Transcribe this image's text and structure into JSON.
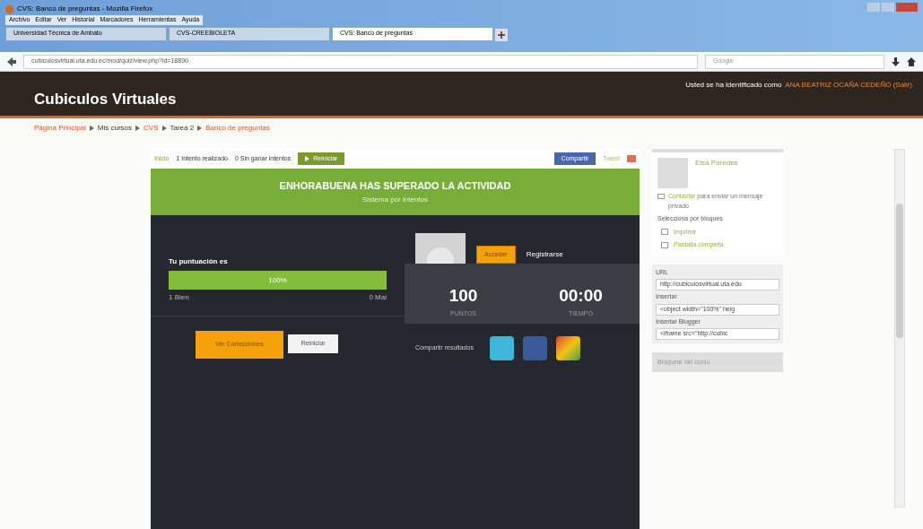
{
  "window": {
    "title": "CVS: Banco de preguntas - Mozilla Firefox"
  },
  "menu": [
    "Archivo",
    "Editar",
    "Ver",
    "Historial",
    "Marcadores",
    "Herramientas",
    "Ayuda"
  ],
  "tabs": [
    {
      "label": "Universidad Técnica de Ambato",
      "selected": false
    },
    {
      "label": "CVS-CREEBIOLETA",
      "selected": false
    },
    {
      "label": "CVS: Banco de preguntas",
      "selected": true
    }
  ],
  "address": {
    "value": "cubiculosvirtual.uta.edu.ec/mod/quiz/view.php?id=18890"
  },
  "search": {
    "placeholder": "Google"
  },
  "header": {
    "site_name": "Cubiculos Virtuales",
    "login_text": "Usted se ha identificado como",
    "user": "ANA BEATRIZ OCAÑA CEDEÑO (Salir)"
  },
  "breadcrumb": [
    {
      "label": "Página Principal",
      "link": true
    },
    {
      "label": "Mis cursos",
      "link": false
    },
    {
      "label": "CVS",
      "link": true
    },
    {
      "label": "Tarea 2",
      "link": false
    },
    {
      "label": "Banco de preguntas",
      "link": true
    }
  ],
  "quiz": {
    "toolbar": {
      "home": "Inicio",
      "attempts": "1 Intento realizado",
      "remaining": "0 Sin ganar intentos",
      "restart": "Reiniciar",
      "share": "Compartir",
      "tweet": "Tweet"
    },
    "banner": {
      "title": "ENHORABUENA HAS SUPERADO LA ACTIVIDAD",
      "subtitle": "Sistema por intentos"
    },
    "score": {
      "label": "Tu puntuación es",
      "level": 1,
      "reading": "100%",
      "correct": "1 Bien",
      "wrong": "0 Mal"
    },
    "account": {
      "login": "Acceder",
      "register": "Registrarse"
    },
    "stats": [
      {
        "value": "100",
        "label": "PUNTOS"
      },
      {
        "value": "00:00",
        "label": "TIEMPO"
      }
    ],
    "buttons": [
      {
        "label": "Ver Correcciones",
        "kind": "primary"
      },
      {
        "label": "Reiniciar",
        "kind": "secondary"
      }
    ],
    "share_label": "Compartir resultados"
  },
  "sidebar": {
    "teacher": "Elsa Paredes",
    "message_link": "Contactar",
    "message_text": "para enviar un mensaje privado",
    "options_title": "Selecciona por bloques",
    "options": [
      "Imprimir",
      "Pantalla completa"
    ],
    "embed": [
      {
        "label": "URL",
        "value": "http://cubiculosvirtual.uta.edu"
      },
      {
        "label": "Insertar",
        "value": "<object width=\"100%\" heig"
      },
      {
        "label": "Insertar Blogger",
        "value": "<iframe src=\"http://cubic"
      }
    ],
    "remove_button": "Bloquear del curso"
  }
}
